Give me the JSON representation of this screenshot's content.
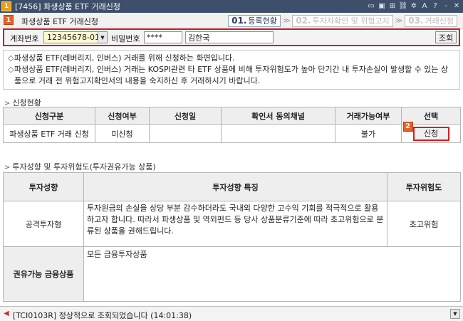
{
  "window": {
    "app_icon": "1",
    "title": "[7456] 파생상품 ETF 거래신청",
    "controls": [
      "▭",
      "▣",
      "⊞",
      "⛓",
      "✲",
      "A",
      "?",
      "-",
      "✕"
    ]
  },
  "header": {
    "badge": "1",
    "title": "파생상품 ETF 거래신청",
    "steps": [
      {
        "num": "01.",
        "label": "등록현황"
      },
      {
        "num": "02.",
        "label": "투자자확인 및 위험고지"
      },
      {
        "num": "03.",
        "label": "거래신청"
      }
    ],
    "arrow": "≫"
  },
  "account": {
    "account_label": "계좌번호",
    "account_value": "12345678-01",
    "password_label": "비밀번호",
    "password_value": "****",
    "name_value": "김한국",
    "query_button": "조회"
  },
  "notice": {
    "lines": [
      "파생상품 ETF(레버리지, 인버스) 거래를 위해 신청하는 화면입니다.",
      "파생상품 ETF(레버리지, 인버스) 거래는 KOSPI관련 타 ETF 상품에 비해 투자위험도가 높아 단기간 내 투자손실이 발생할 수 있는 상품으로 거래 전 위험고지확인서의 내용을 숙지하신 후 거래하시기 바랍니다."
    ]
  },
  "status_section": {
    "title": "신청현황",
    "columns": [
      "신청구분",
      "신청여부",
      "신청일",
      "확인서 동의채널",
      "거래가능여부",
      "선택"
    ],
    "row": {
      "type": "파생상품 ETF 거래 신청",
      "applied": "미신청",
      "date": "",
      "channel": "",
      "tradable": "불가",
      "button": "신청",
      "badge": "2"
    }
  },
  "investment_section": {
    "title": "투자성향 및 투자위험도(투자권유가능 상품)",
    "columns": [
      "투자성향",
      "투자성향 특징",
      "투자위험도"
    ],
    "row": {
      "type": "공격투자형",
      "description": "투자원금의 손실을 상당 부분 감수하더라도 국내외 다양한 고수익 기회를 적극적으로 활용하고자 합니다. 따라서 파생상품 및 역외펀드 등 당사 상품분류기준에 따라 초고위험으로 분류된 상품을 권해드립니다.",
      "risk": "초고위험"
    },
    "product_label": "권유가능 금융상품",
    "product_value": "모든 금융투자상품"
  },
  "statusbar": {
    "message": "[TCI0103R] 정상적으로 조회되었습니다 (14:01:38)"
  }
}
